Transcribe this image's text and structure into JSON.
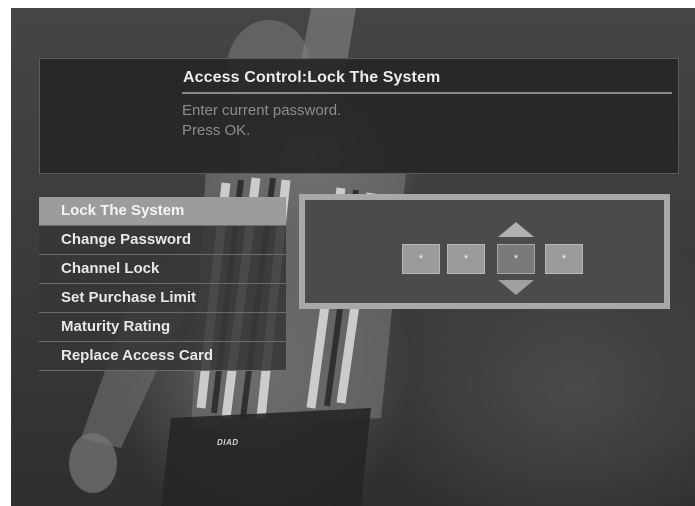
{
  "header": {
    "title": "Access Control:Lock The System",
    "instruction_line1": "Enter current password.",
    "instruction_line2": "Press OK."
  },
  "menu": {
    "items": [
      {
        "label": "Lock The System",
        "selected": true
      },
      {
        "label": "Change Password",
        "selected": false
      },
      {
        "label": "Channel Lock",
        "selected": false
      },
      {
        "label": "Set Purchase Limit",
        "selected": false
      },
      {
        "label": "Maturity Rating",
        "selected": false
      },
      {
        "label": "Replace Access Card",
        "selected": false
      }
    ]
  },
  "pin_entry": {
    "digits": [
      "*",
      "*",
      "*",
      "*"
    ],
    "active_digit": 3,
    "up_icon": "arrow-up-icon",
    "down_icon": "arrow-down-icon"
  },
  "background": {
    "jersey_logo_text": "DIAD"
  },
  "colors": {
    "selected_item": "#9c9c9c",
    "panel_bg": "#262626",
    "panel_border": "#a8a8a8",
    "title_text": "#ececec",
    "instruction_text": "#8d8d8d"
  }
}
